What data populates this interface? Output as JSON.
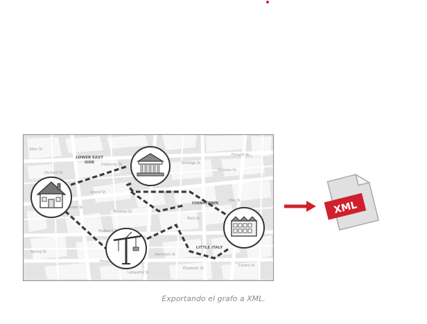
{
  "map": {
    "districts": [
      {
        "id": "les",
        "lines": [
          "LOWER EAST",
          "SIDE"
        ]
      },
      {
        "id": "chinatown",
        "lines": [
          "CHINATOWN"
        ]
      },
      {
        "id": "little-italy",
        "lines": [
          "LITTLE ITALY"
        ]
      }
    ],
    "streets": [
      "Delancey St",
      "Grand St",
      "Canal St",
      "Hester St",
      "Broome St",
      "Mott St",
      "Mulberry St",
      "Bowery",
      "Prince St",
      "Spring St",
      "Kenmare St",
      "Division St",
      "Forsyth St",
      "Eldridge St",
      "Allen St",
      "Pike St",
      "Orchard St",
      "Elizabeth St",
      "Centre St",
      "Lafayette St"
    ],
    "nodes": [
      {
        "id": "house",
        "icon": "house-icon"
      },
      {
        "id": "bank",
        "icon": "bank-icon"
      },
      {
        "id": "factory",
        "icon": "factory-icon"
      },
      {
        "id": "crane",
        "icon": "crane-icon"
      }
    ]
  },
  "export": {
    "badge": "XML",
    "accent": "#d0202e",
    "arrow_color": "#d0202e"
  },
  "caption": "Exportando el grafo a XML."
}
